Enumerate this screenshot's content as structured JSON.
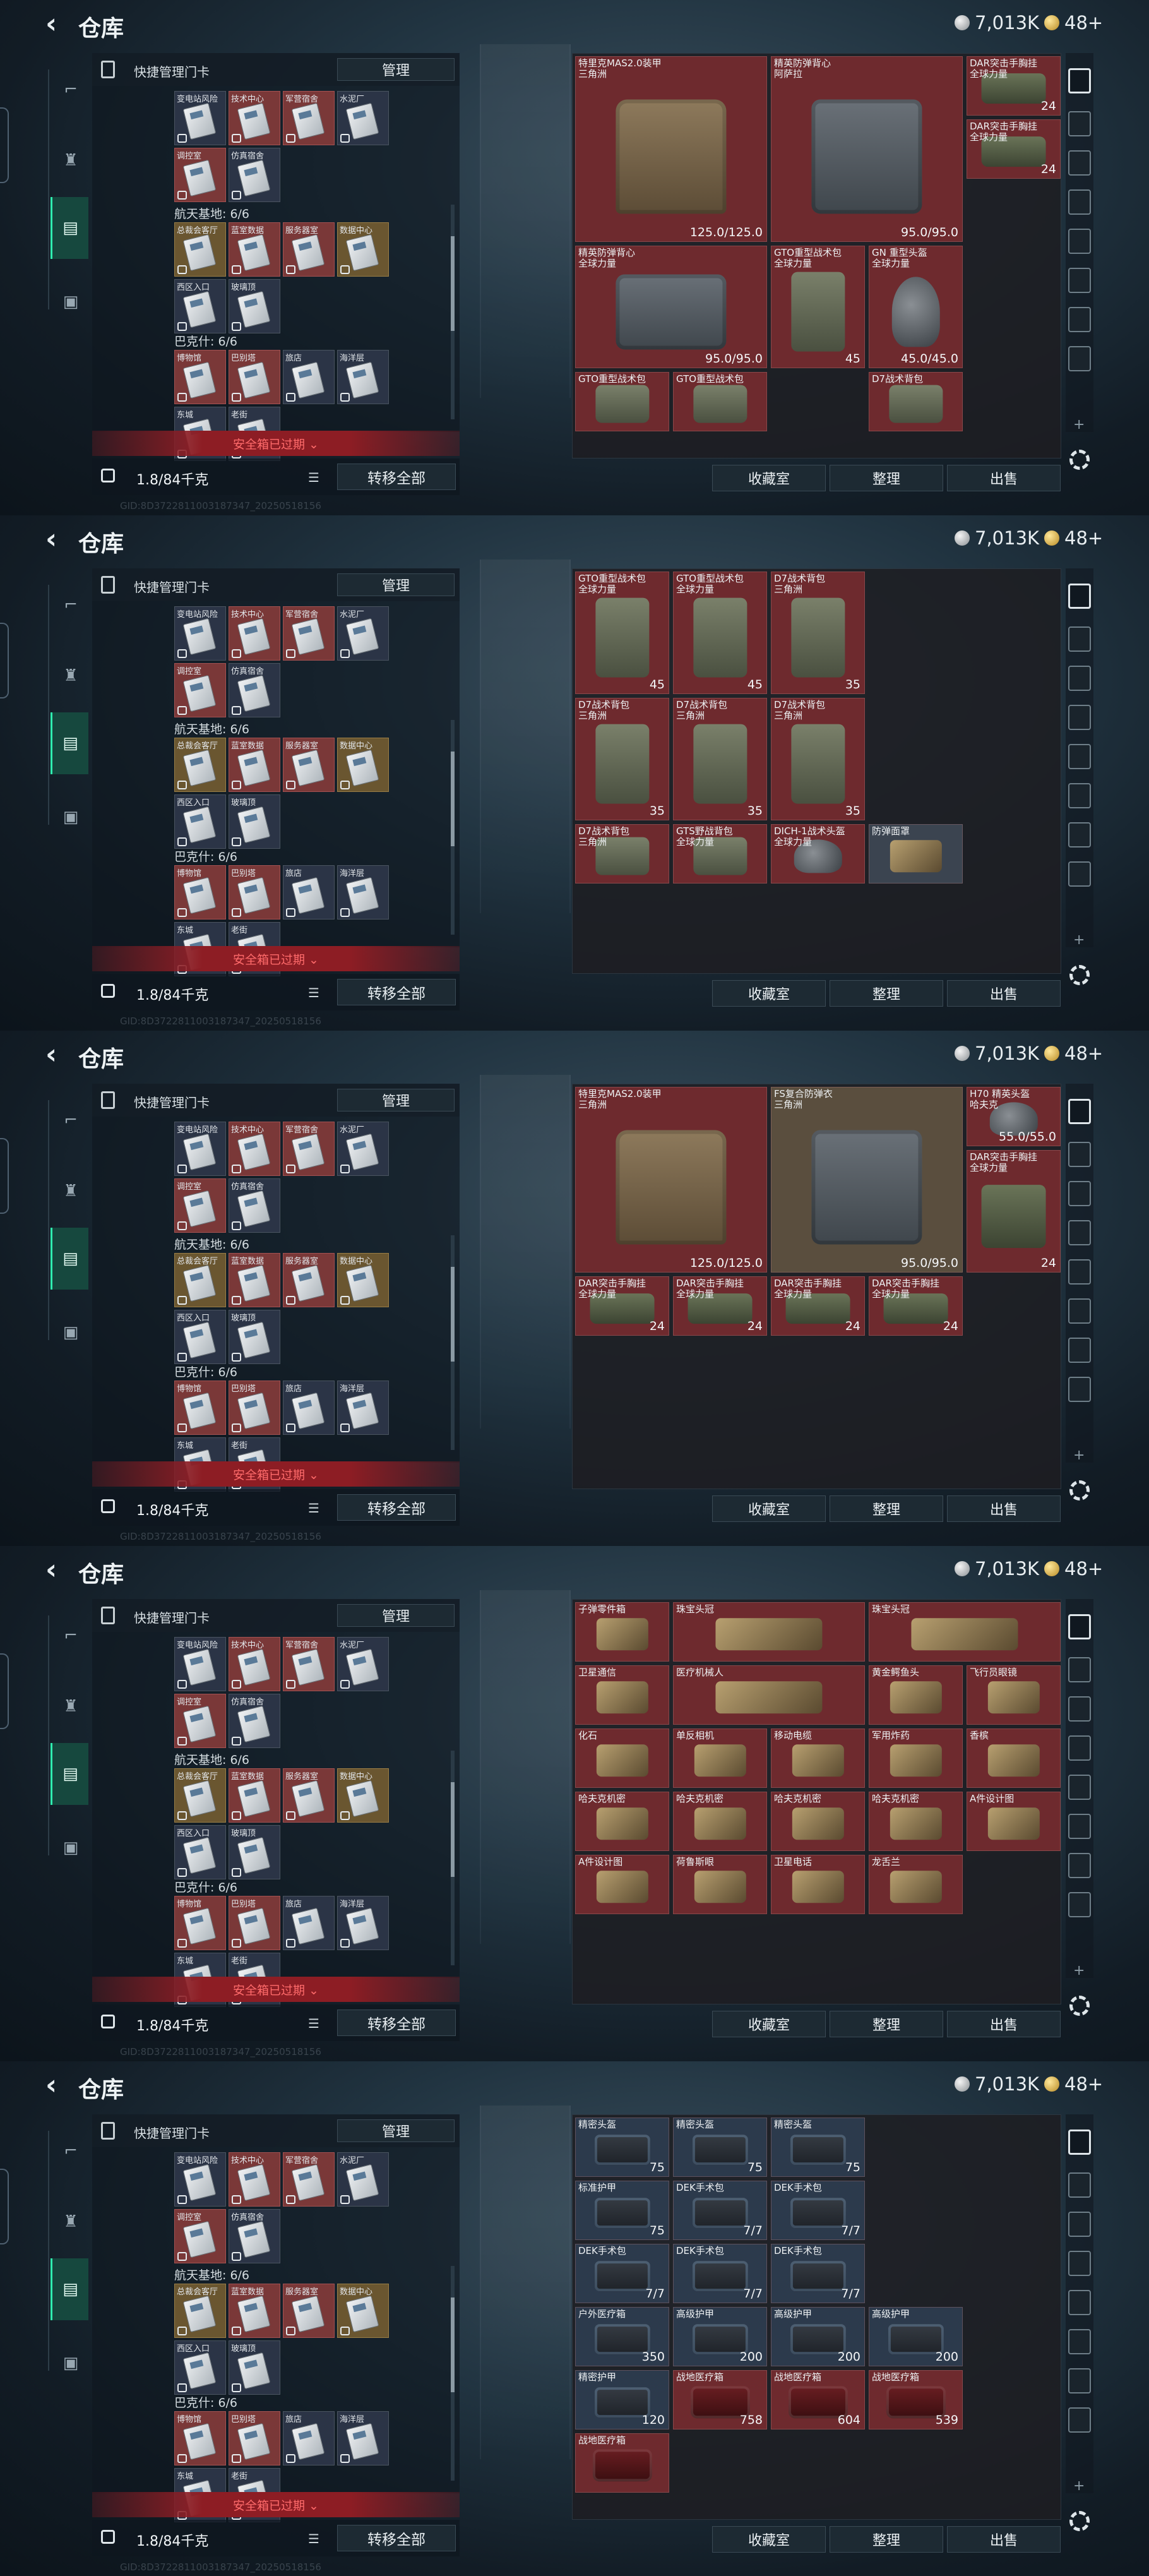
{
  "header": {
    "title": "仓库",
    "currency_silver": "7,013K",
    "currency_gold": "48+"
  },
  "left": {
    "card_header": "快捷管理门卡",
    "manage_btn": "管理",
    "sections": [
      "航天基地: 6/6",
      "巴克什: 6/6"
    ],
    "cards_row1": [
      "变电站风险",
      "技术中心",
      "军营宿舍",
      "水泥厂"
    ],
    "cards_row2": [
      "调控室",
      "仿真宿舍"
    ],
    "cards_row3": [
      "总裁会客厅",
      "蓝室数据",
      "服务器室",
      "数据中心"
    ],
    "cards_row4": [
      "西区入口",
      "玻璃顶"
    ],
    "cards_row5": [
      "博物馆",
      "巴别塔",
      "旅店",
      "海洋层"
    ],
    "cards_row6": [
      "东城",
      "老街"
    ],
    "warn": "安全箱已过期 ⌄",
    "weight": "1.8/84千克",
    "transfer_btn": "转移全部",
    "watermark": "GID:8D3722811003187347_20250518156"
  },
  "buttons": {
    "collect": "收藏室",
    "tidy": "整理",
    "sell": "出售"
  },
  "panels": [
    {
      "cells": [
        {
          "n": "特里克MAS2.0装甲\n三角洲",
          "v": "125.0/125.0",
          "t": "armor",
          "c": "r",
          "x": 0,
          "y": 0,
          "w": 2,
          "h": 3
        },
        {
          "n": "精英防弹背心\n阿萨拉",
          "v": "95.0/95.0",
          "t": "vest",
          "c": "r",
          "x": 2,
          "y": 0,
          "w": 2,
          "h": 3
        },
        {
          "n": "DAR突击手胸挂\n全球力量",
          "v": "24",
          "t": "rig",
          "c": "r",
          "x": 4,
          "y": 0,
          "w": 1,
          "h": 1
        },
        {
          "n": "DAR突击手胸挂\n全球力量",
          "v": "24",
          "t": "rig",
          "c": "r",
          "x": 4,
          "y": 1,
          "w": 1,
          "h": 1
        },
        {
          "n": "精英防弹背心\n全球力量",
          "v": "95.0/95.0",
          "t": "vest",
          "c": "r",
          "x": 0,
          "y": 3,
          "w": 2,
          "h": 2
        },
        {
          "n": "GTO重型战术包\n全球力量",
          "v": "45",
          "t": "pack",
          "c": "r",
          "x": 2,
          "y": 3,
          "w": 1,
          "h": 2
        },
        {
          "n": "GN 重型头盔\n全球力量",
          "v": "45.0/45.0",
          "t": "helm",
          "c": "r",
          "x": 3,
          "y": 3,
          "w": 1,
          "h": 2
        },
        {
          "n": "GTO重型战术包",
          "v": "",
          "t": "pack",
          "c": "r",
          "x": 0,
          "y": 5,
          "w": 1,
          "h": 1
        },
        {
          "n": "GTO重型战术包",
          "v": "",
          "t": "pack",
          "c": "r",
          "x": 1,
          "y": 5,
          "w": 1,
          "h": 1
        },
        {
          "n": "D7战术背包",
          "v": "",
          "t": "pack",
          "c": "r",
          "x": 3,
          "y": 5,
          "w": 1,
          "h": 1
        }
      ]
    },
    {
      "cells": [
        {
          "n": "GTO重型战术包\n全球力量",
          "v": "45",
          "t": "pack",
          "c": "r",
          "x": 0,
          "y": 0,
          "w": 1,
          "h": 2
        },
        {
          "n": "GTO重型战术包\n全球力量",
          "v": "45",
          "t": "pack",
          "c": "r",
          "x": 1,
          "y": 0,
          "w": 1,
          "h": 2
        },
        {
          "n": "D7战术背包\n三角洲",
          "v": "35",
          "t": "pack",
          "c": "r",
          "x": 2,
          "y": 0,
          "w": 1,
          "h": 2
        },
        {
          "n": "D7战术背包\n三角洲",
          "v": "35",
          "t": "pack",
          "c": "r",
          "x": 0,
          "y": 2,
          "w": 1,
          "h": 2
        },
        {
          "n": "D7战术背包\n三角洲",
          "v": "35",
          "t": "pack",
          "c": "r",
          "x": 1,
          "y": 2,
          "w": 1,
          "h": 2
        },
        {
          "n": "D7战术背包\n三角洲",
          "v": "35",
          "t": "pack",
          "c": "r",
          "x": 2,
          "y": 2,
          "w": 1,
          "h": 2
        },
        {
          "n": "D7战术背包\n三角洲",
          "v": "",
          "t": "pack",
          "c": "r",
          "x": 0,
          "y": 4,
          "w": 1,
          "h": 1
        },
        {
          "n": "GTS野战背包\n全球力量",
          "v": "",
          "t": "pack",
          "c": "r",
          "x": 1,
          "y": 4,
          "w": 1,
          "h": 1
        },
        {
          "n": "DICH-1战术头盔\n全球力量",
          "v": "",
          "t": "helm",
          "c": "r",
          "x": 2,
          "y": 4,
          "w": 1,
          "h": 1
        },
        {
          "n": "防弹面罩",
          "v": "",
          "t": "item",
          "c": "c",
          "x": 3,
          "y": 4,
          "w": 1,
          "h": 1
        }
      ]
    },
    {
      "cells": [
        {
          "n": "特里克MAS2.0装甲\n三角洲",
          "v": "125.0/125.0",
          "t": "armor",
          "c": "r",
          "x": 0,
          "y": 0,
          "w": 2,
          "h": 3
        },
        {
          "n": "FS复合防弹衣\n三角洲",
          "v": "95.0/95.0",
          "t": "vest",
          "c": "g",
          "x": 2,
          "y": 0,
          "w": 2,
          "h": 3
        },
        {
          "n": "H70 精英头盔\n哈夫克",
          "v": "55.0/55.0",
          "t": "helm",
          "c": "r",
          "x": 4,
          "y": 0,
          "w": 1,
          "h": 1
        },
        {
          "n": "DAR突击手胸挂\n全球力量",
          "v": "24",
          "t": "rig",
          "c": "r",
          "x": 4,
          "y": 1,
          "w": 1,
          "h": 2
        },
        {
          "n": "DAR突击手胸挂\n全球力量",
          "v": "24",
          "t": "rig",
          "c": "r",
          "x": 0,
          "y": 3,
          "w": 1,
          "h": 1
        },
        {
          "n": "DAR突击手胸挂\n全球力量",
          "v": "24",
          "t": "rig",
          "c": "r",
          "x": 1,
          "y": 3,
          "w": 1,
          "h": 1
        },
        {
          "n": "DAR突击手胸挂\n全球力量",
          "v": "24",
          "t": "rig",
          "c": "r",
          "x": 2,
          "y": 3,
          "w": 1,
          "h": 1
        },
        {
          "n": "DAR突击手胸挂\n全球力量",
          "v": "24",
          "t": "rig",
          "c": "r",
          "x": 3,
          "y": 3,
          "w": 1,
          "h": 1
        }
      ]
    },
    {
      "cells": [
        {
          "n": "子弹零件箱",
          "v": "",
          "t": "item",
          "c": "r",
          "x": 0,
          "y": 0,
          "w": 1,
          "h": 1
        },
        {
          "n": "珠宝头冠",
          "v": "",
          "t": "item",
          "c": "r",
          "x": 1,
          "y": 0,
          "w": 2,
          "h": 1
        },
        {
          "n": "珠宝头冠",
          "v": "",
          "t": "item",
          "c": "r",
          "x": 3,
          "y": 0,
          "w": 2,
          "h": 1
        },
        {
          "n": "卫星通信",
          "v": "",
          "t": "item",
          "c": "r",
          "x": 0,
          "y": 1,
          "w": 1,
          "h": 1
        },
        {
          "n": "医疗机械人",
          "v": "",
          "t": "item",
          "c": "r",
          "x": 1,
          "y": 1,
          "w": 2,
          "h": 1
        },
        {
          "n": "黄金鳄鱼头",
          "v": "",
          "t": "item",
          "c": "r",
          "x": 3,
          "y": 1,
          "w": 1,
          "h": 1
        },
        {
          "n": "飞行员眼镜",
          "v": "",
          "t": "item",
          "c": "r",
          "x": 4,
          "y": 1,
          "w": 1,
          "h": 1
        },
        {
          "n": "单反相机",
          "v": "",
          "t": "item",
          "c": "r",
          "x": 1,
          "y": 2,
          "w": 1,
          "h": 1
        },
        {
          "n": "移动电缆",
          "v": "",
          "t": "item",
          "c": "r",
          "x": 2,
          "y": 2,
          "w": 1,
          "h": 1
        },
        {
          "n": "军用炸药",
          "v": "",
          "t": "item",
          "c": "r",
          "x": 3,
          "y": 2,
          "w": 1,
          "h": 1
        },
        {
          "n": "香槟",
          "v": "",
          "t": "item",
          "c": "r",
          "x": 4,
          "y": 2,
          "w": 1,
          "h": 1
        },
        {
          "n": "化石",
          "v": "",
          "t": "item",
          "c": "r",
          "x": 0,
          "y": 2,
          "w": 1,
          "h": 1
        },
        {
          "n": "哈夫克机密",
          "v": "",
          "t": "item",
          "c": "r",
          "x": 0,
          "y": 3,
          "w": 1,
          "h": 1
        },
        {
          "n": "哈夫克机密",
          "v": "",
          "t": "item",
          "c": "r",
          "x": 1,
          "y": 3,
          "w": 1,
          "h": 1
        },
        {
          "n": "哈夫克机密",
          "v": "",
          "t": "item",
          "c": "r",
          "x": 2,
          "y": 3,
          "w": 1,
          "h": 1
        },
        {
          "n": "哈夫克机密",
          "v": "",
          "t": "item",
          "c": "r",
          "x": 3,
          "y": 3,
          "w": 1,
          "h": 1
        },
        {
          "n": "A件设计图",
          "v": "",
          "t": "item",
          "c": "r",
          "x": 4,
          "y": 3,
          "w": 1,
          "h": 1
        },
        {
          "n": "A件设计图",
          "v": "",
          "t": "item",
          "c": "r",
          "x": 0,
          "y": 4,
          "w": 1,
          "h": 1
        },
        {
          "n": "荷鲁斯眼",
          "v": "",
          "t": "item",
          "c": "r",
          "x": 1,
          "y": 4,
          "w": 1,
          "h": 1
        },
        {
          "n": "卫星电话",
          "v": "",
          "t": "item",
          "c": "r",
          "x": 2,
          "y": 4,
          "w": 1,
          "h": 1
        },
        {
          "n": "龙舌兰",
          "v": "",
          "t": "item",
          "c": "r",
          "x": 3,
          "y": 4,
          "w": 1,
          "h": 1
        }
      ]
    },
    {
      "cells": [
        {
          "n": "精密头盔",
          "v": "75",
          "t": "med",
          "c": "b",
          "x": 0,
          "y": 0,
          "w": 1,
          "h": 1
        },
        {
          "n": "精密头盔",
          "v": "75",
          "t": "med",
          "c": "b",
          "x": 1,
          "y": 0,
          "w": 1,
          "h": 1
        },
        {
          "n": "精密头盔",
          "v": "75",
          "t": "med",
          "c": "b",
          "x": 2,
          "y": 0,
          "w": 1,
          "h": 1
        },
        {
          "n": "标准护甲",
          "v": "75",
          "t": "med",
          "c": "b",
          "x": 0,
          "y": 1,
          "w": 1,
          "h": 1
        },
        {
          "n": "DEK手术包",
          "v": "7/7",
          "t": "med",
          "c": "b",
          "x": 1,
          "y": 1,
          "w": 1,
          "h": 1
        },
        {
          "n": "DEK手术包",
          "v": "7/7",
          "t": "med",
          "c": "b",
          "x": 2,
          "y": 1,
          "w": 1,
          "h": 1
        },
        {
          "n": "DEK手术包",
          "v": "7/7",
          "t": "med",
          "c": "b",
          "x": 0,
          "y": 2,
          "w": 1,
          "h": 1
        },
        {
          "n": "DEK手术包",
          "v": "7/7",
          "t": "med",
          "c": "b",
          "x": 1,
          "y": 2,
          "w": 1,
          "h": 1
        },
        {
          "n": "DEK手术包",
          "v": "7/7",
          "t": "med",
          "c": "b",
          "x": 2,
          "y": 2,
          "w": 1,
          "h": 1
        },
        {
          "n": "户外医疗箱",
          "v": "350",
          "t": "med",
          "c": "b",
          "x": 0,
          "y": 3,
          "w": 1,
          "h": 1
        },
        {
          "n": "高级护甲",
          "v": "200",
          "t": "med",
          "c": "b",
          "x": 1,
          "y": 3,
          "w": 1,
          "h": 1
        },
        {
          "n": "高级护甲",
          "v": "200",
          "t": "med",
          "c": "b",
          "x": 2,
          "y": 3,
          "w": 1,
          "h": 1
        },
        {
          "n": "高级护甲",
          "v": "200",
          "t": "med",
          "c": "b",
          "x": 3,
          "y": 3,
          "w": 1,
          "h": 1
        },
        {
          "n": "精密护甲",
          "v": "120",
          "t": "med",
          "c": "b",
          "x": 0,
          "y": 4,
          "w": 1,
          "h": 1
        },
        {
          "n": "战地医疗箱",
          "v": "758",
          "t": "kit",
          "c": "r",
          "x": 1,
          "y": 4,
          "w": 1,
          "h": 1
        },
        {
          "n": "战地医疗箱",
          "v": "604",
          "t": "kit",
          "c": "r",
          "x": 2,
          "y": 4,
          "w": 1,
          "h": 1
        },
        {
          "n": "战地医疗箱",
          "v": "539",
          "t": "kit",
          "c": "r",
          "x": 3,
          "y": 4,
          "w": 1,
          "h": 1
        },
        {
          "n": "战地医疗箱",
          "v": "",
          "t": "kit",
          "c": "r",
          "x": 0,
          "y": 5,
          "w": 1,
          "h": 1
        }
      ]
    }
  ]
}
